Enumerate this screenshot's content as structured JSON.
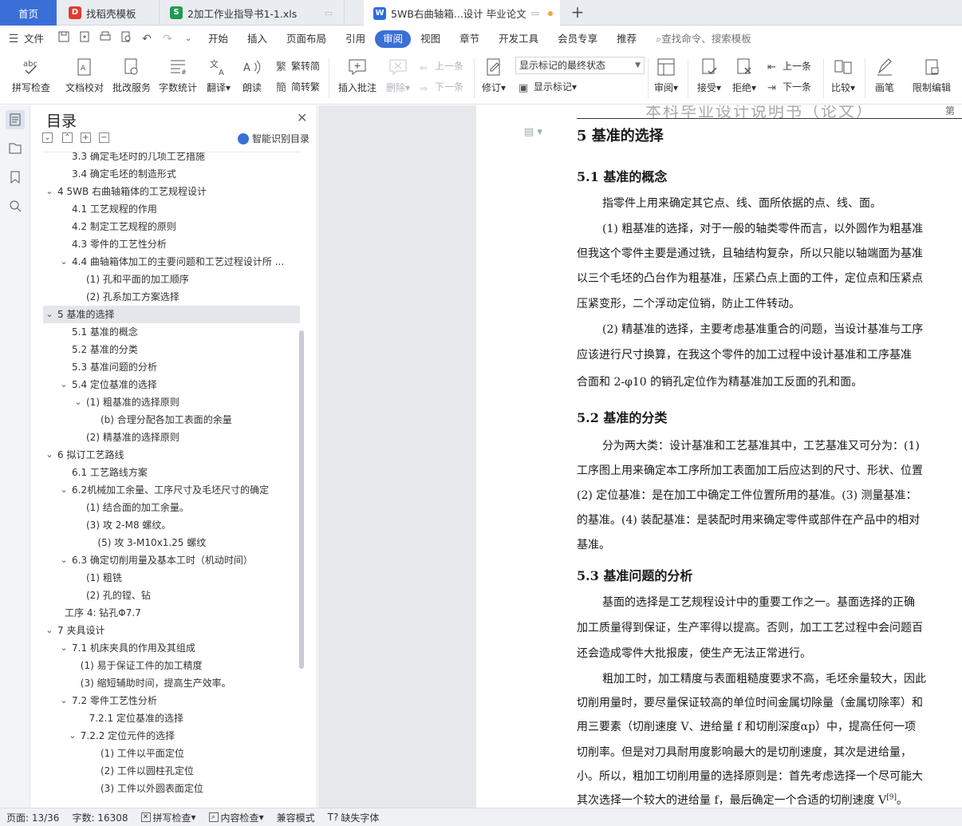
{
  "tabs": {
    "home": "首页",
    "t1": "找稻壳模板",
    "t2": "2加工作业指导书1-1.xls",
    "t3": "5WB右曲轴箱...设计 毕业论文"
  },
  "menu": {
    "file": "文件",
    "items": [
      "开始",
      "插入",
      "页面布局",
      "引用",
      "审阅",
      "视图",
      "章节",
      "开发工具",
      "会员专享",
      "推荐"
    ],
    "active": "审阅",
    "search_placeholder": "查找命令、搜索模板"
  },
  "ribbon": {
    "spell_check": "拼写检查",
    "doc_proof": "文档校对",
    "batch_service": "批改服务",
    "word_count": "字数统计",
    "translate": "翻译",
    "read_aloud": "朗读",
    "trad_to_simp": "繁转简",
    "simp_to_trad": "简转繁",
    "insert_comment": "插入批注",
    "delete": "删除",
    "prev_comment": "上一条",
    "next_comment": "下一条",
    "track_changes": "修订",
    "markup_select": "显示标记的最终状态",
    "show_markup": "显示标记",
    "review": "审阅",
    "accept": "接受",
    "reject": "拒绝",
    "prev_change": "上一条",
    "next_change": "下一条",
    "compare": "比较",
    "pen": "画笔",
    "restrict_edit": "限制编辑"
  },
  "toc": {
    "title": "目录",
    "smart_label": "智能识别目录",
    "items": [
      {
        "text": "3.3   确定毛坯时的几项工艺措施",
        "level": 1,
        "chev": ""
      },
      {
        "text": "3.4   确定毛坯的制造形式",
        "level": 1,
        "chev": ""
      },
      {
        "text": "4    5WB 右曲轴箱体的工艺规程设计",
        "level": 0,
        "chev": "v"
      },
      {
        "text": "4.1   工艺规程的作用",
        "level": 1,
        "chev": ""
      },
      {
        "text": "4.2   制定工艺规程的原则",
        "level": 1,
        "chev": ""
      },
      {
        "text": "4.3   零件的工艺性分析",
        "level": 1,
        "chev": ""
      },
      {
        "text": "4.4   曲轴箱体加工的主要问题和工艺过程设计所 ...",
        "level": 1,
        "chev": "v"
      },
      {
        "text": "(1)   孔和平面的加工顺序",
        "level": 2,
        "chev": ""
      },
      {
        "text": "(2)   孔系加工方案选择",
        "level": 2,
        "chev": ""
      },
      {
        "text": "5   基准的选择",
        "level": 0,
        "chev": "v",
        "selected": true
      },
      {
        "text": "5.1   基准的概念",
        "level": 1,
        "chev": ""
      },
      {
        "text": "5.2   基准的分类",
        "level": 1,
        "chev": ""
      },
      {
        "text": "5.3   基准问题的分析",
        "level": 1,
        "chev": ""
      },
      {
        "text": "5.4   定位基准的选择",
        "level": 1,
        "chev": "v"
      },
      {
        "text": "(1) 粗基准的选择原则",
        "level": 2,
        "chev": "v"
      },
      {
        "text": "(b) 合理分配各加工表面的余量",
        "level": 3,
        "chev": ""
      },
      {
        "text": "(2) 精基准的选择原则",
        "level": 2,
        "chev": ""
      },
      {
        "text": "6   拟订工艺路线",
        "level": 0,
        "chev": "v"
      },
      {
        "text": "6.1   工艺路线方案",
        "level": 1,
        "chev": ""
      },
      {
        "text": "6.2机械加工余量、工序尺寸及毛坯尺寸的确定",
        "level": 1,
        "chev": "v"
      },
      {
        "text": "(1)   结合面的加工余量。",
        "level": 2,
        "chev": ""
      },
      {
        "text": "(3)   攻 2-M8 螺纹。",
        "level": 2,
        "chev": ""
      },
      {
        "text": "(5)   攻 3-M10x1.25 螺纹",
        "level": 25,
        "chev": ""
      },
      {
        "text": "6.3   确定切削用量及基本工时（机动时间）",
        "level": 1,
        "chev": "v"
      },
      {
        "text": "(1)   粗铣",
        "level": 2,
        "chev": ""
      },
      {
        "text": "(2)   孔的镗、钻",
        "level": 2,
        "chev": ""
      },
      {
        "text": "工序 4:  钻孔Φ7.7",
        "level": 0.5,
        "chev": ""
      },
      {
        "text": "7   夹具设计",
        "level": 0,
        "chev": "v"
      },
      {
        "text": "7.1   机床夹具的作用及其组成",
        "level": 1,
        "chev": "v"
      },
      {
        "text": "(1) 易于保证工件的加工精度",
        "level": 1.6,
        "chev": ""
      },
      {
        "text": "(3) 缩短辅助时间，提高生产效率。",
        "level": 1.6,
        "chev": ""
      },
      {
        "text": "7.2   零件工艺性分析",
        "level": 1,
        "chev": "v"
      },
      {
        "text": "7.2.1   定位基准的选择",
        "level": 2.2,
        "chev": ""
      },
      {
        "text": "7.2.2   定位元件的选择",
        "level": 1.6,
        "chev": "v"
      },
      {
        "text": "(1) 工件以平面定位",
        "level": 3,
        "chev": ""
      },
      {
        "text": "(2) 工件以圆柱孔定位",
        "level": 3,
        "chev": ""
      },
      {
        "text": "(3) 工件以外圆表面定位",
        "level": 3,
        "chev": ""
      }
    ]
  },
  "document": {
    "header_text": "本科毕业设计说明书（论文）",
    "header_right": "第",
    "h1": "5    基准的选择",
    "h51": "5.1    基准的概念",
    "p511": "指零件上用来确定其它点、线、面所依据的点、线、面。",
    "p512": "(1) 粗基准的选择，对于一般的轴类零件而言，以外圆作为粗基准",
    "p513": "但我这个零件主要是通过铣，且轴结构复杂，所以只能以轴端面为基准",
    "p514": "以三个毛坯的凸台作为粗基准，压紧凸点上面的工件，定位点和压紧点",
    "p515": "压紧变形，二个浮动定位销，防止工件转动。",
    "p516": "(2) 精基准的选择，主要考虑基准重合的问题，当设计基准与工序",
    "p517": "应该进行尺寸换算，在我这个零件的加工过程中设计基准和工序基准",
    "p518": "合面和 2-φ10 的销孔定位作为精基准加工反面的孔和面。",
    "h52": "5.2    基准的分类",
    "p521": "分为两大类：设计基准和工艺基准其中，工艺基准又可分为：(1)",
    "p522": "工序图上用来确定本工序所加工表面加工后应达到的尺寸、形状、位置",
    "p523": "(2) 定位基准：是在加工中确定工件位置所用的基准。(3) 测量基准：",
    "p524": "的基准。(4) 装配基准：是装配时用来确定零件或部件在产品中的相对",
    "p525": "基准。",
    "h53": "5.3    基准问题的分析",
    "p531": "基面的选择是工艺规程设计中的重要工作之一。基面选择的正确",
    "p532": "加工质量得到保证，生产率得以提高。否则，加工工艺过程中会问题百",
    "p533": "还会造成零件大批报废，使生产无法正常进行。",
    "p534": "粗加工时，加工精度与表面粗糙度要求不高，毛坯余量较大，因此",
    "p535": "切削用量时，要尽量保证较高的单位时间金属切除量（金属切除率）和",
    "p536": "用三要素（切削速度 V、进给量 f 和切削深度αp）中，提高任何一项",
    "p537": "切削率。但是对刀具耐用度影响最大的是切削速度，其次是进给量，",
    "p538": "小。所以，粗加工切削用量的选择原则是：首先考虑选择一个尽可能大",
    "p539": "其次选择一个较大的进给量 f，最后确定一个合适的切削速度 V",
    "p539_sup": "[9]",
    "p539_end": "。"
  },
  "status": {
    "page": "页面: 13/36",
    "words": "字数: 16308",
    "spell": "拼写检查",
    "content": "内容检查",
    "compat": "兼容模式",
    "missing_font": "缺失字体"
  },
  "colors": {
    "accent": "#3a6fd8",
    "tab_bar": "#e9ecf1",
    "doc_bg": "#e6e8ec"
  }
}
